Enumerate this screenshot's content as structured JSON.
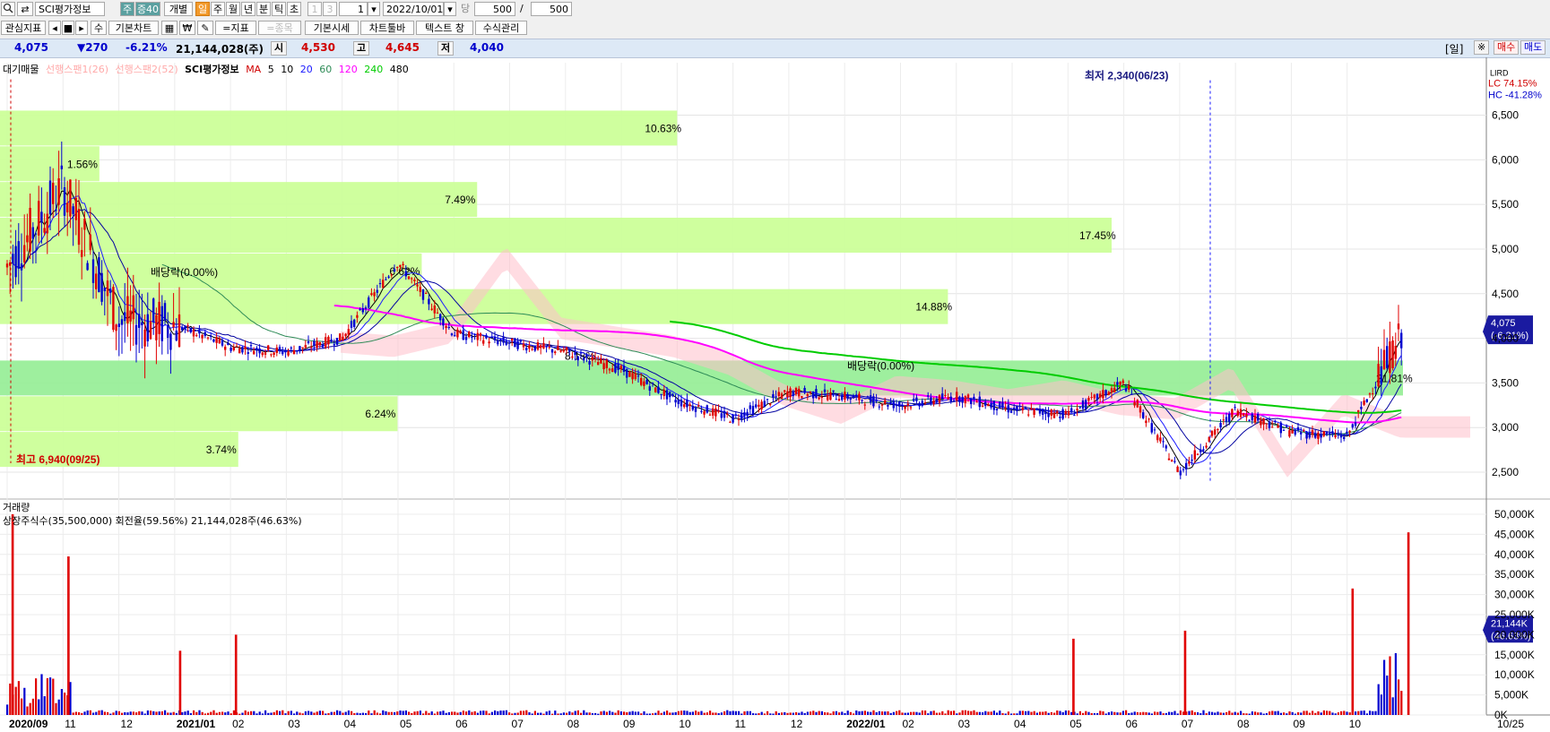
{
  "toolbar": {
    "search_icon": "search-icon",
    "swap_icon": "swap-icon",
    "stock_name": "SCI평가정보",
    "badge_ju": "주",
    "badge_jeung": "증40",
    "gaebyeol": "개별",
    "periods": [
      "일",
      "주",
      "월",
      "년",
      "분",
      "틱",
      "초"
    ],
    "period_active": "일",
    "num1": "1",
    "num3": "3",
    "count_value": "1",
    "date_value": "2022/10/01",
    "dang": "당",
    "qty1": "500",
    "slash": "/",
    "qty2": "500",
    "indicator_btn": "관심지표",
    "su_btn": "수",
    "basic_chart_btn": "기본차트",
    "won_icon": "₩",
    "index_btn": "=지표",
    "item_btn": "=종목",
    "basic_price_btn": "기본시세",
    "chart_toolbar_btn": "차트툴바",
    "text_window_btn": "텍스트 창",
    "formula_btn": "수식관리"
  },
  "price": {
    "current": "4,075",
    "change": "▼270",
    "change_pct": "-6.21%",
    "volume": "21,144,028(주)",
    "open_label": "시",
    "open": "4,530",
    "high_label": "고",
    "high": "4,645",
    "low_label": "저",
    "low": "4,040",
    "period_label": "[일]",
    "buy": "매수",
    "sell": "매도"
  },
  "legend": {
    "daegi": "대기매물",
    "span1": "선행스팬1(26)",
    "span2": "선행스팬2(52)",
    "sci": "SCI평가정보",
    "ma": "MA",
    "ma_periods": [
      "5",
      "10",
      "20",
      "60",
      "120",
      "240",
      "480"
    ]
  },
  "colors": {
    "up": "#e00000",
    "down": "#0000d0",
    "ma5": "#000000",
    "ma10": "#1a1aff",
    "ma20": "#0000a0",
    "ma60": "#2e8b57",
    "ma120": "#ff00ff",
    "ma240": "#00cc00",
    "ma480": "#000000",
    "supply_light": "#ccff99",
    "supply_main": "#99ee99",
    "cloud": "#ffc0cb"
  },
  "annotations": {
    "low": "최저 2,340(06/23)",
    "high": "최고 6,940(09/25)",
    "div1": "배당락(0.00%)",
    "div2": "배당락(0.00%)",
    "lc": "LC  74.15%",
    "hc": "HC -41.28%",
    "lird": "LIRD"
  },
  "chart_data": [
    {
      "type": "candlestick",
      "title": "SCI평가정보",
      "y_ticks": [
        "6,500",
        "6,000",
        "5,500",
        "5,000",
        "4,500",
        "4,000",
        "3,500",
        "3,000",
        "2,500"
      ],
      "ylim": [
        2200,
        7000
      ],
      "current_label": "4,075",
      "current_pct": "(-6.21%)",
      "x_ticks": [
        "2020/09",
        "11",
        "12",
        "2021/01",
        "02",
        "03",
        "04",
        "05",
        "06",
        "07",
        "08",
        "09",
        "10",
        "11",
        "12",
        "2022/01",
        "02",
        "03",
        "04",
        "05",
        "06",
        "07",
        "08",
        "09",
        "10"
      ],
      "approx_close": [
        [
          "2020/09",
          4800
        ],
        [
          "2020/10",
          5700
        ],
        [
          "2020/11",
          4200
        ],
        [
          "2020/12",
          4150
        ],
        [
          "2021/01",
          3900
        ],
        [
          "2021/02",
          3850
        ],
        [
          "2021/03",
          4000
        ],
        [
          "2021/04",
          4850
        ],
        [
          "2021/05",
          4050
        ],
        [
          "2021/06",
          3950
        ],
        [
          "2021/07",
          3850
        ],
        [
          "2021/08",
          3650
        ],
        [
          "2021/09",
          3300
        ],
        [
          "2021/10",
          3100
        ],
        [
          "2021/11",
          3400
        ],
        [
          "2021/12",
          3350
        ],
        [
          "2022/01",
          3250
        ],
        [
          "2022/02",
          3350
        ],
        [
          "2022/03",
          3200
        ],
        [
          "2022/04",
          3150
        ],
        [
          "2022/05",
          3500
        ],
        [
          "2022/06",
          2500
        ],
        [
          "2022/07",
          3200
        ],
        [
          "2022/08",
          2950
        ],
        [
          "2022/09",
          2900
        ],
        [
          "2022/10",
          4075
        ]
      ],
      "supply_zones": [
        {
          "label": "10.63%",
          "price": 6350,
          "weight": 10.63
        },
        {
          "label": "1.56%",
          "price": 5950,
          "weight": 1.56
        },
        {
          "label": "7.49%",
          "price": 5550,
          "weight": 7.49
        },
        {
          "label": "17.45%",
          "price": 5150,
          "weight": 17.45
        },
        {
          "label": "6.62%",
          "price": 4750,
          "weight": 6.62
        },
        {
          "label": "14.88%",
          "price": 4350,
          "weight": 14.88
        },
        {
          "label": "21.81%",
          "price": 3550,
          "weight": 21.81
        },
        {
          "label": "6.24%",
          "price": 3150,
          "weight": 6.24
        },
        {
          "label": "3.74%",
          "price": 2750,
          "weight": 3.74
        }
      ],
      "supply_hidden_label": "8.18%"
    },
    {
      "type": "bar",
      "title": "거래량",
      "subtitle": "상장주식수(35,500,000) 회전율(59.56%) 21,144,028주(46.63%)",
      "y_ticks": [
        "50,000K",
        "45,000K",
        "40,000K",
        "35,000K",
        "30,000K",
        "25,000K",
        "20,000K",
        "15,000K",
        "10,000K",
        "5,000K",
        "0K"
      ],
      "ylim": [
        0,
        50000
      ],
      "current_label": "21,144K",
      "current_pct": "(46.63%)",
      "peaks_k": [
        [
          "2020/09",
          50000
        ],
        [
          "2020/10",
          39500
        ],
        [
          "2020/12",
          16000
        ],
        [
          "2021/01",
          20000
        ],
        [
          "2022/04",
          19000
        ],
        [
          "2022/06",
          21000
        ],
        [
          "2022/09",
          31500
        ],
        [
          "2022/10",
          45500
        ]
      ],
      "x_end_label": "10/25"
    }
  ]
}
